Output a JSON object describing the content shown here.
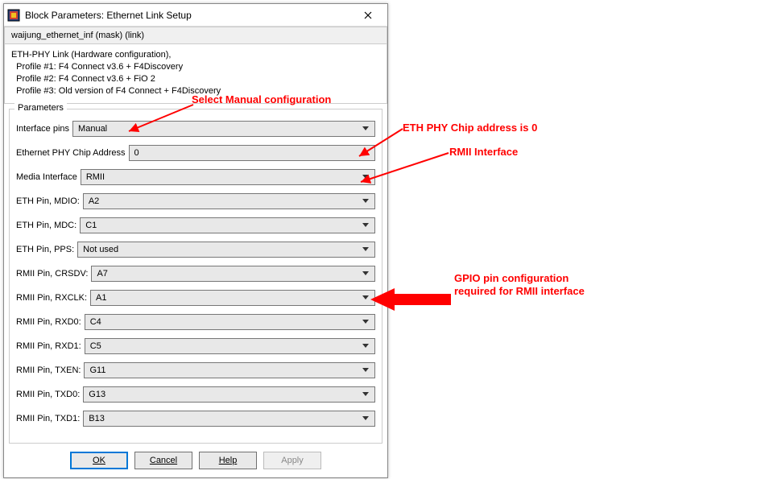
{
  "title": "Block Parameters: Ethernet Link Setup",
  "mask_line": "waijung_ethernet_inf (mask) (link)",
  "description": {
    "line1": "ETH-PHY Link (Hardware configuration),",
    "line2": "  Profile #1: F4 Connect v3.6 + F4Discovery",
    "line3": "  Profile #2: F4 Connect v3.6 + FiO 2",
    "line4": "  Profile #3: Old version of F4 Connect + F4Discovery"
  },
  "params_legend": "Parameters",
  "rows": {
    "interface_pins": {
      "label": "Interface pins",
      "value": "Manual"
    },
    "phy_addr": {
      "label": "Ethernet PHY Chip Address",
      "value": "0"
    },
    "media_interface": {
      "label": "Media Interface",
      "value": "RMII"
    },
    "mdio": {
      "label": "ETH Pin, MDIO:",
      "value": "A2"
    },
    "mdc": {
      "label": "ETH Pin, MDC:",
      "value": "C1"
    },
    "pps": {
      "label": "ETH Pin, PPS:",
      "value": "Not used"
    },
    "crsdv": {
      "label": "RMII Pin, CRSDV:",
      "value": "A7"
    },
    "rxclk": {
      "label": "RMII Pin, RXCLK:",
      "value": "A1"
    },
    "rxd0": {
      "label": "RMII Pin, RXD0:",
      "value": "C4"
    },
    "rxd1": {
      "label": "RMII Pin, RXD1:",
      "value": "C5"
    },
    "txen": {
      "label": "RMII Pin, TXEN:",
      "value": "G11"
    },
    "txd0": {
      "label": "RMII Pin, TXD0:",
      "value": "G13"
    },
    "txd1": {
      "label": "RMII Pin, TXD1:",
      "value": "B13"
    }
  },
  "buttons": {
    "ok": "OK",
    "cancel": "Cancel",
    "help": "Help",
    "apply": "Apply"
  },
  "annotations": {
    "a1": "Select Manual configuration",
    "a2": "ETH PHY Chip address is 0",
    "a3": "RMII Interface",
    "a4_line1": "GPIO pin configuration",
    "a4_line2": "required for RMII interface"
  }
}
